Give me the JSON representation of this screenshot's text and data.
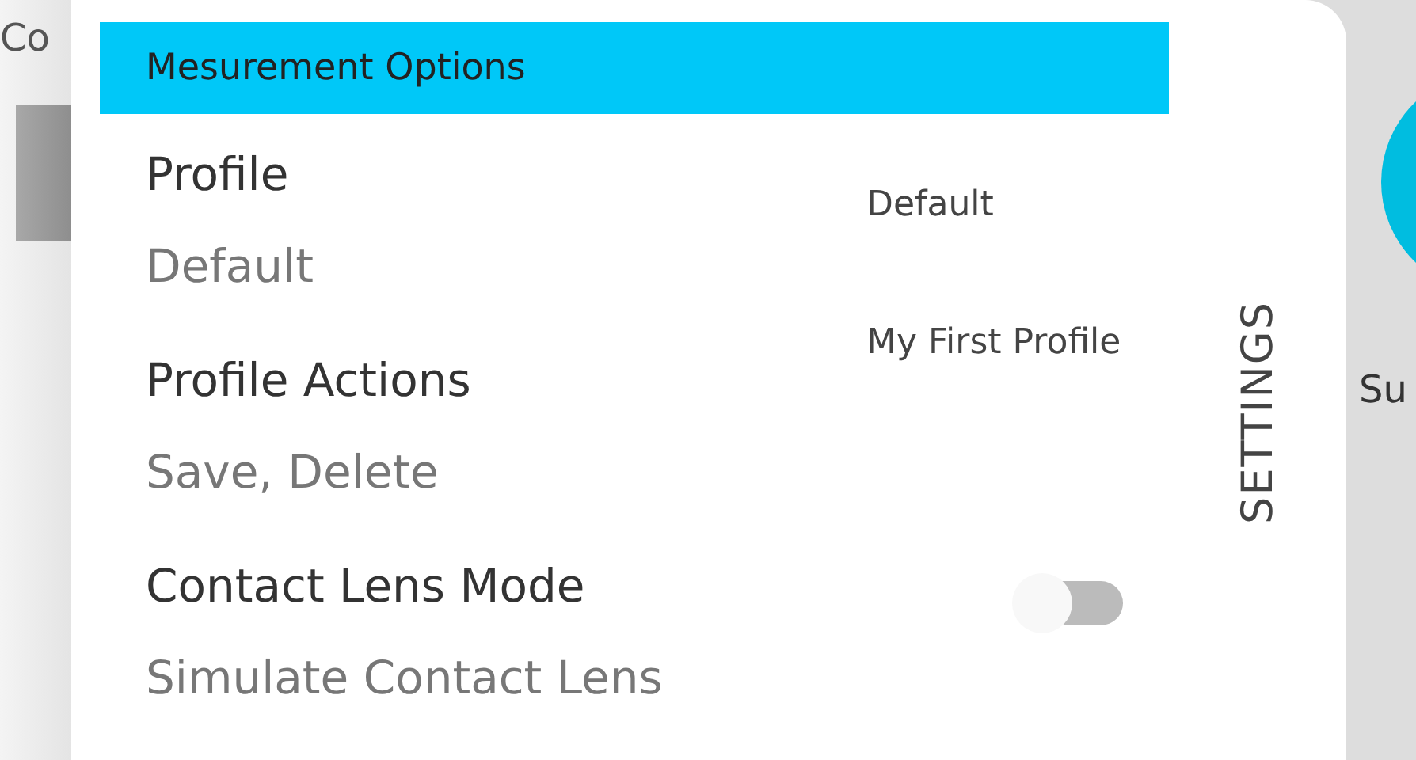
{
  "background_left": {
    "text": "Co"
  },
  "dialog": {
    "header": "Mesurement Options",
    "settings": [
      {
        "kind": "text",
        "title": "Profile",
        "subtitle": "Default"
      },
      {
        "kind": "text",
        "title": "Profile Actions",
        "subtitle": "Save, Delete"
      },
      {
        "kind": "toggle",
        "title": "Contact Lens Mode",
        "subtitle": "Simulate Contact Lens",
        "on": false
      }
    ],
    "profile_options": [
      "Default",
      "My First Profile"
    ],
    "side_tab": "SETTINGS"
  },
  "background_right": {
    "text": "Su"
  }
}
